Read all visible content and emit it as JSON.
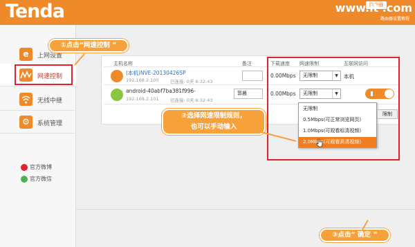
{
  "header": {
    "logo": "Tenda",
    "watermark": "www.it .com",
    "watermark_badge": "路由器",
    "watermark_small": "路由器设置教程"
  },
  "sidebar": {
    "items": [
      {
        "label": "上网设置",
        "icon": "e-internet-icon"
      },
      {
        "label": "网速控制",
        "icon": "speed-wave-icon"
      },
      {
        "label": "无线中继",
        "icon": "wireless-repeat-icon"
      },
      {
        "label": "系统管理",
        "icon": "system-gear-icon"
      }
    ],
    "social": [
      {
        "label": "官方微博",
        "icon": "weibo-icon"
      },
      {
        "label": "官方微信",
        "icon": "wechat-icon"
      }
    ]
  },
  "table": {
    "headers": [
      "主机名称",
      "备注",
      "下载速度",
      "网速限制",
      "互联网访问"
    ],
    "rows": [
      {
        "name": "(本机)NVE-20130426SP",
        "ip": "192.168.2.100",
        "connected": "已连接: 0天 6:32:43",
        "remark": "",
        "speed": "0.00Mbps",
        "limit": "无限制",
        "access": "本机"
      },
      {
        "name": "android-40abf7ba381f996-",
        "ip": "192.168.2.101",
        "connected": "已连接: 0天 6:32:43",
        "remark": "郭晨",
        "speed": "0.00Mbps",
        "limit": "无限制",
        "access": "on"
      }
    ]
  },
  "dropdown": {
    "options": [
      "无限制",
      "0.5Mbps(可正常浏览网页)",
      "1.0Mbps(可观看标清视频)",
      "2.0Mbps(可观看高清视频)"
    ],
    "selected_index": 3
  },
  "save_button_partial": "限制",
  "callouts": {
    "step1": "①点击“网速控制 ”",
    "step2_line1": "②选择网速限制规则，",
    "step2_line2": "也可以手动输入",
    "step3": "③点击“ 确定 ”"
  },
  "colors": {
    "brand": "#ef8a2b",
    "highlight": "#e0202a",
    "callout": "#f6a13a"
  }
}
